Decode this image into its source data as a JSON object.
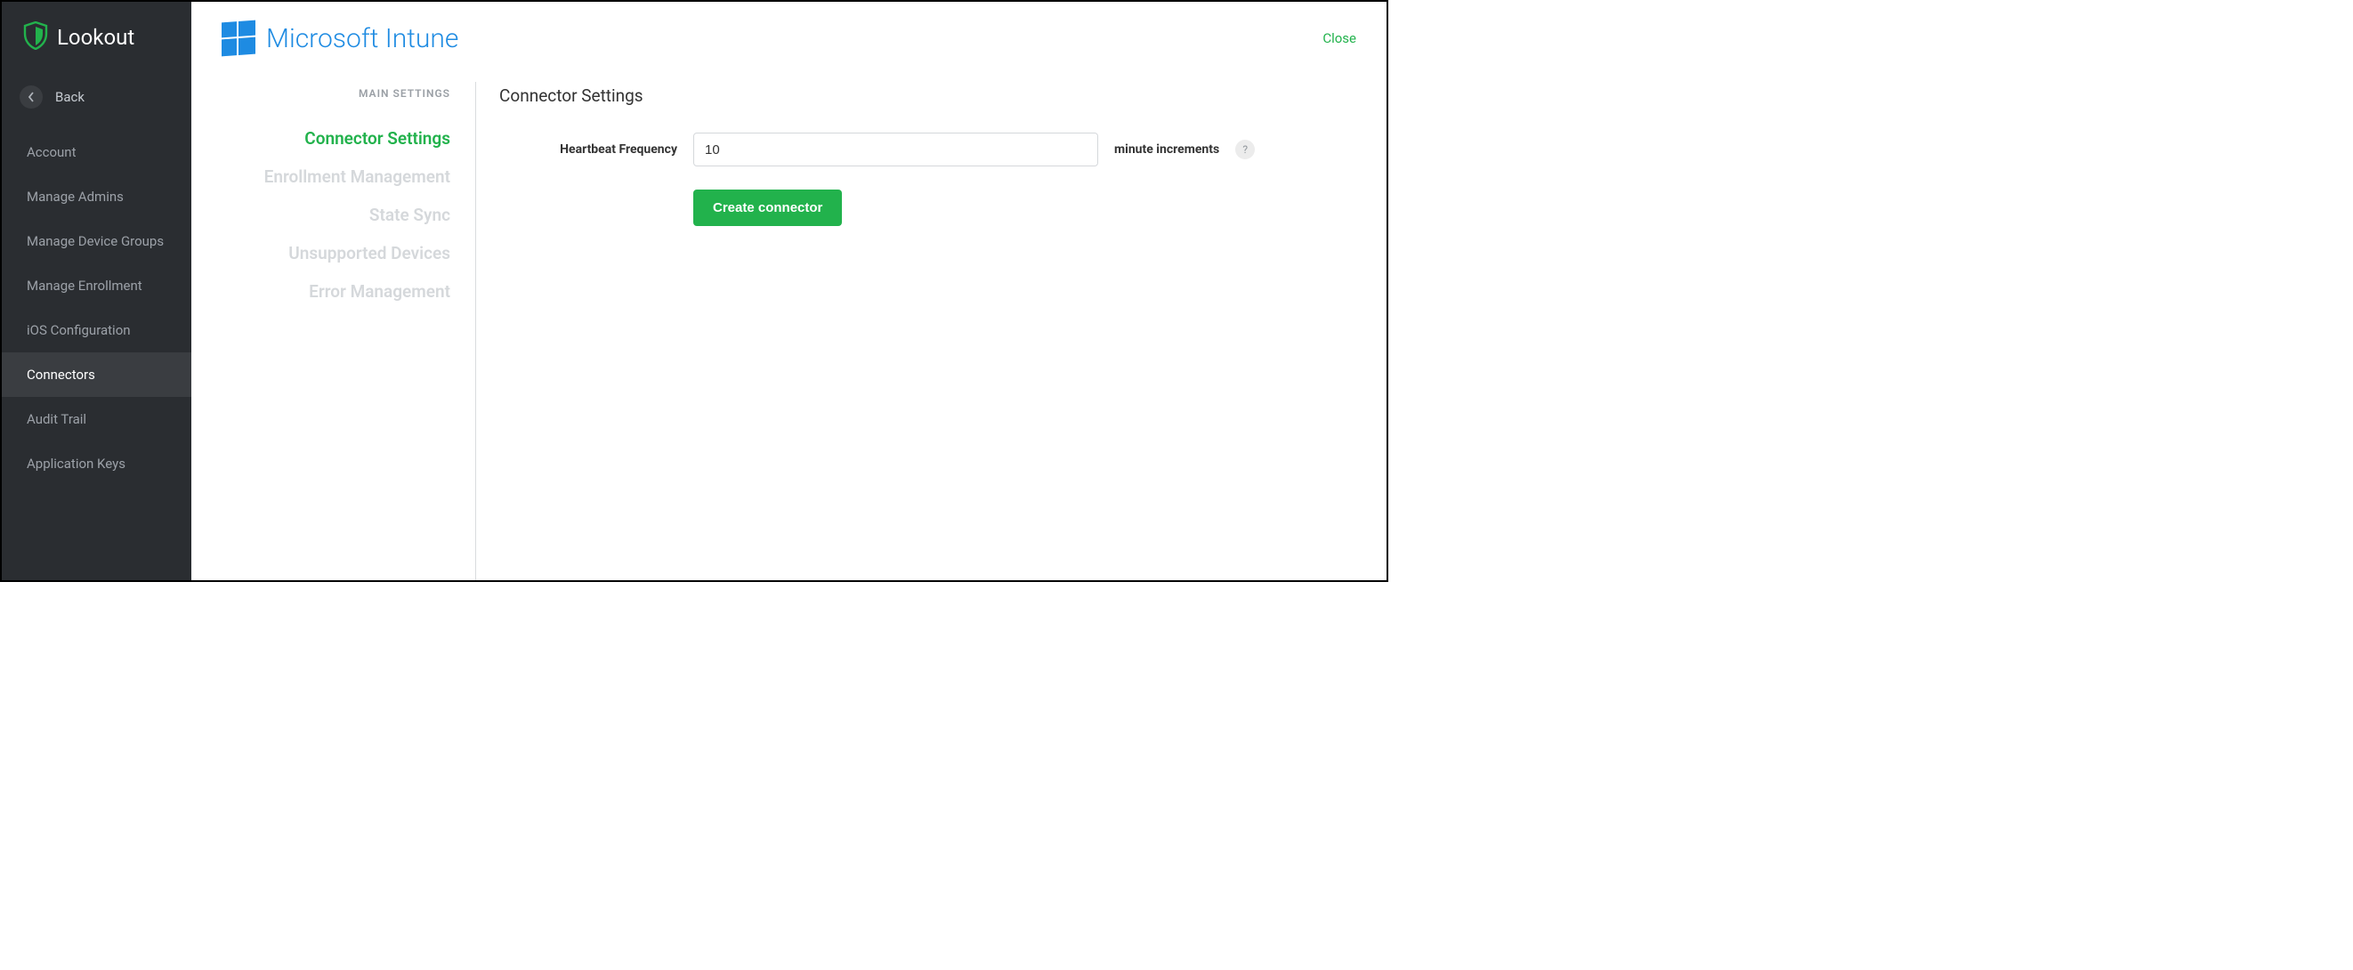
{
  "brand": {
    "name": "Lookout"
  },
  "sidebar": {
    "back_label": "Back",
    "items": [
      {
        "label": "Account"
      },
      {
        "label": "Manage Admins"
      },
      {
        "label": "Manage Device Groups"
      },
      {
        "label": "Manage Enrollment"
      },
      {
        "label": "iOS Configuration"
      },
      {
        "label": "Connectors"
      },
      {
        "label": "Audit Trail"
      },
      {
        "label": "Application Keys"
      }
    ],
    "active_index": 5
  },
  "header": {
    "product": "Microsoft Intune",
    "close_label": "Close"
  },
  "settings_nav": {
    "header": "MAIN SETTINGS",
    "items": [
      {
        "label": "Connector Settings",
        "state": "active"
      },
      {
        "label": "Enrollment Management",
        "state": "disabled"
      },
      {
        "label": "State Sync",
        "state": "disabled"
      },
      {
        "label": "Unsupported Devices",
        "state": "disabled"
      },
      {
        "label": "Error Management",
        "state": "disabled"
      }
    ]
  },
  "panel": {
    "title": "Connector Settings",
    "heartbeat_label": "Heartbeat Frequency",
    "heartbeat_value": "10",
    "heartbeat_suffix": "minute increments",
    "help_char": "?",
    "create_button": "Create connector"
  }
}
